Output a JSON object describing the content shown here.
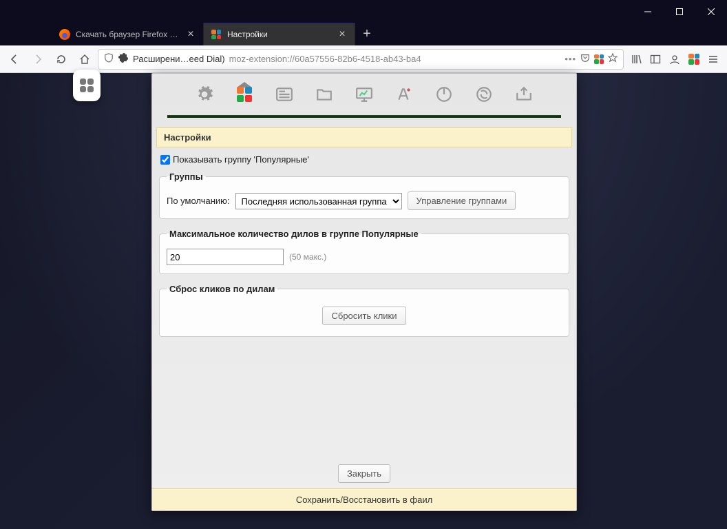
{
  "window": {
    "tabs": [
      {
        "title": "Скачать браузер Firefox для ко",
        "active": false
      },
      {
        "title": "Настройки",
        "active": true
      }
    ],
    "new_tab_tooltip": "+"
  },
  "navbar": {
    "extension_label": "Расширени…eed Dial)",
    "url": "moz-extension://60a57556-82b6-4518-ab43-ba4",
    "page_actions_glyph": "•••"
  },
  "settings": {
    "header": "Настройки",
    "show_popular_label": "Показывать группу 'Популярные'",
    "show_popular_checked": true,
    "groups": {
      "legend": "Группы",
      "default_label": "По умолчанию:",
      "select_value": "Последняя использованная группа",
      "options": [
        "Последняя использованная группа"
      ],
      "manage_button": "Управление группами"
    },
    "max_dials": {
      "legend": "Максимальное количество дилов в группе Популярные",
      "value": "20",
      "hint": "(50 макс.)"
    },
    "reset_clicks": {
      "legend": "Сброс кликов по дилам",
      "button": "Сбросить клики"
    },
    "close_button": "Закрыть",
    "footer": "Сохранить/Восстановить в фаил"
  }
}
